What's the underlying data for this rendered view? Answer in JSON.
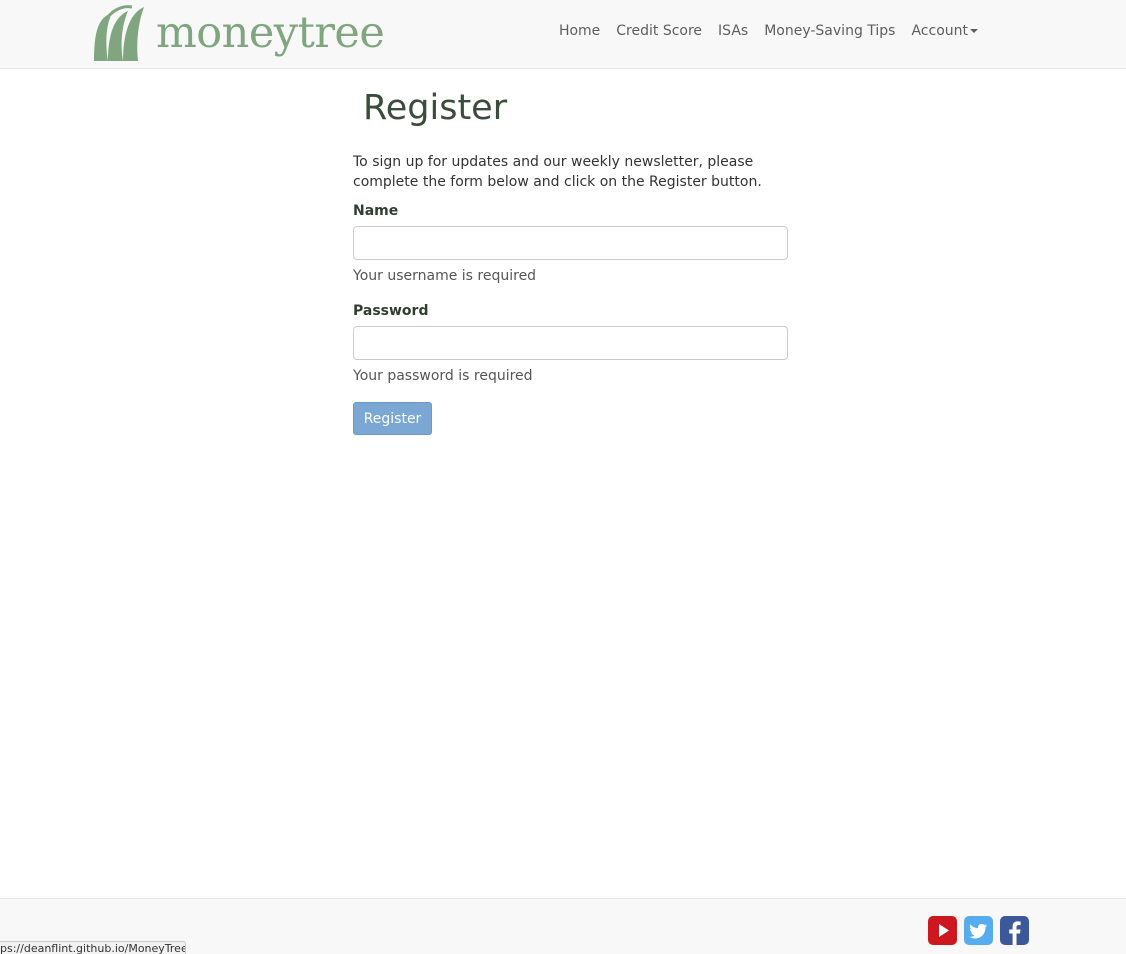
{
  "brand": {
    "name": "moneytree",
    "color": "#7fa67f"
  },
  "nav": {
    "items": [
      "Home",
      "Credit Score",
      "ISAs",
      "Money-Saving Tips"
    ],
    "account_label": "Account"
  },
  "page": {
    "title": "Register",
    "intro_line1": "To sign up for updates and our weekly newsletter, please",
    "intro_line2": "complete the form below and click on the Register button."
  },
  "form": {
    "name_label": "Name",
    "name_value": "",
    "name_help": "Your username is required",
    "password_label": "Password",
    "password_value": "",
    "password_help": "Your password is required",
    "submit_label": "Register"
  },
  "footer": {
    "social_icons": [
      "youtube-icon",
      "twitter-icon",
      "facebook-icon"
    ]
  },
  "status_bar": {
    "url": "ps://deanflint.github.io/MoneyTree/"
  },
  "colors": {
    "button": "#7aa7d3",
    "heading": "#3c4c3c",
    "youtube": "#cc181e",
    "twitter": "#55acee",
    "facebook": "#3b5998"
  }
}
